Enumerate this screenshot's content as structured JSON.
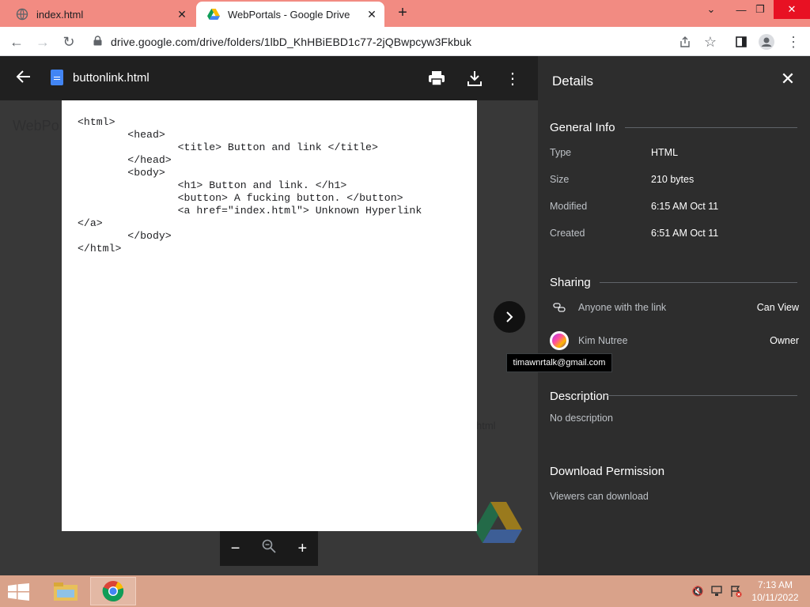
{
  "browser": {
    "tabs": [
      {
        "title": "index.html",
        "active": false
      },
      {
        "title": "WebPortals - Google Drive",
        "active": true
      }
    ],
    "url": "drive.google.com/drive/folders/1lbD_KhHBiEBD1c77-2jQBwpcyw3Fkbuk"
  },
  "background": {
    "page_title": "WebPo",
    "partial_text": "html"
  },
  "viewer": {
    "file_name": "buttonlink.html",
    "file_text": "<html>\n        <head>\n                <title> Button and link </title>\n        </head>\n        <body>\n                <h1> Button and link. </h1>\n                <button> A fucking button. </button>\n                <a href=\"index.html\"> Unknown Hyperlink\n</a>\n        </body>\n</html>",
    "zoom_out": "−",
    "zoom_in": "+"
  },
  "details": {
    "title": "Details",
    "general_info": {
      "heading": "General Info",
      "rows": [
        {
          "key": "Type",
          "value": "HTML"
        },
        {
          "key": "Size",
          "value": "210 bytes"
        },
        {
          "key": "Modified",
          "value": "6:15 AM Oct 11"
        },
        {
          "key": "Created",
          "value": "6:51 AM Oct 11"
        }
      ]
    },
    "sharing": {
      "heading": "Sharing",
      "link_row": {
        "name": "Anyone with the link",
        "role": "Can View"
      },
      "owner_row": {
        "name": "Kim Nutree",
        "role": "Owner"
      },
      "tooltip": "timawnrtalk@gmail.com"
    },
    "description": {
      "heading": "Description",
      "text": "No description"
    },
    "download_permission": {
      "heading": "Download Permission",
      "text": "Viewers can download"
    }
  },
  "taskbar": {
    "time": "7:13 AM",
    "date": "10/11/2022"
  },
  "colors": {
    "tab_strip": "#f28b82",
    "viewer_bg": "#383838",
    "details_bg": "#2d2d2d",
    "taskbar": "#d9a28a"
  }
}
